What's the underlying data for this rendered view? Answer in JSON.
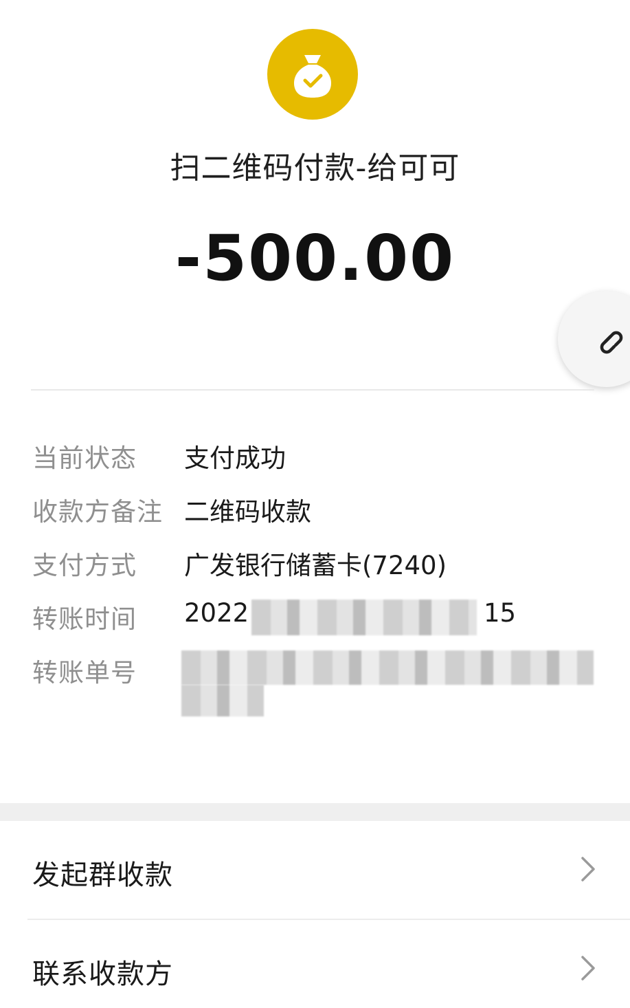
{
  "header": {
    "icon": "money-bag-check-icon",
    "icon_color": "#e6bb00",
    "title": "扫二维码付款-给可可",
    "amount": "-500.00"
  },
  "link_button": {
    "icon": "link-icon"
  },
  "details": [
    {
      "label": "当前状态",
      "value": "支付成功"
    },
    {
      "label": "收款方备注",
      "value": "二维码收款"
    },
    {
      "label": "支付方式",
      "value": "广发银行储蓄卡(7240)"
    },
    {
      "label": "转账时间",
      "value": "2022",
      "value_suffix": "15"
    },
    {
      "label": "转账单号",
      "value": "1"
    }
  ],
  "menu": [
    {
      "label": "发起群收款",
      "icon": "chevron-right-icon"
    },
    {
      "label": "联系收款方",
      "icon": "chevron-right-icon"
    }
  ]
}
